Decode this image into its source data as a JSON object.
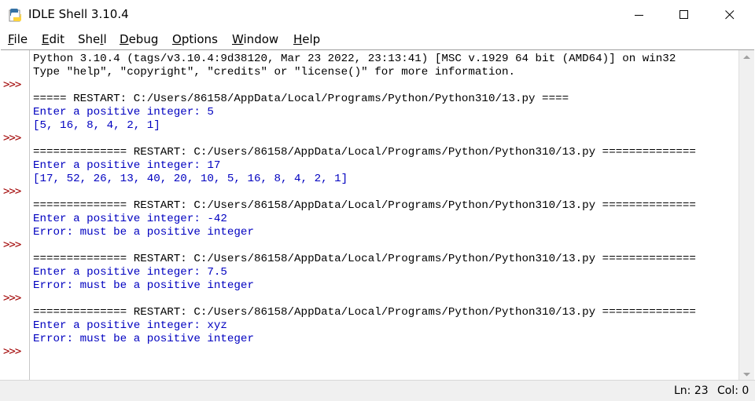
{
  "window": {
    "title": "IDLE Shell 3.10.4",
    "icon": "python-idle-icon"
  },
  "menu": {
    "items": [
      {
        "label_pre": "",
        "label_ul": "F",
        "label_post": "ile"
      },
      {
        "label_pre": "",
        "label_ul": "E",
        "label_post": "dit"
      },
      {
        "label_pre": "She",
        "label_ul": "l",
        "label_post": "l"
      },
      {
        "label_pre": "",
        "label_ul": "D",
        "label_post": "ebug"
      },
      {
        "label_pre": "",
        "label_ul": "O",
        "label_post": "ptions"
      },
      {
        "label_pre": "",
        "label_ul": "W",
        "label_post": "indow"
      },
      {
        "label_pre": "",
        "label_ul": "H",
        "label_post": "elp"
      }
    ]
  },
  "shell": {
    "prompt": ">>>",
    "lines": [
      {
        "text": "Python 3.10.4 (tags/v3.10.4:9d38120, Mar 23 2022, 23:13:41) [MSC v.1929 64 bit (AMD64)] on win32",
        "kind": "plain"
      },
      {
        "text": "Type \"help\", \"copyright\", \"credits\" or \"license()\" for more information.",
        "kind": "plain"
      },
      {
        "text": "",
        "kind": "plain"
      },
      {
        "text": "===== RESTART: C:/Users/86158/AppData/Local/Programs/Python/Python310/13.py ====",
        "kind": "plain"
      },
      {
        "text": "Enter a positive integer: 5",
        "kind": "stdout"
      },
      {
        "text": "[5, 16, 8, 4, 2, 1]",
        "kind": "stdout"
      },
      {
        "text": "",
        "kind": "plain"
      },
      {
        "text": "============== RESTART: C:/Users/86158/AppData/Local/Programs/Python/Python310/13.py ==============",
        "kind": "plain"
      },
      {
        "text": "Enter a positive integer: 17",
        "kind": "stdout"
      },
      {
        "text": "[17, 52, 26, 13, 40, 20, 10, 5, 16, 8, 4, 2, 1]",
        "kind": "stdout"
      },
      {
        "text": "",
        "kind": "plain"
      },
      {
        "text": "============== RESTART: C:/Users/86158/AppData/Local/Programs/Python/Python310/13.py ==============",
        "kind": "plain"
      },
      {
        "text": "Enter a positive integer: -42",
        "kind": "stdout"
      },
      {
        "text": "Error: must be a positive integer",
        "kind": "stdout"
      },
      {
        "text": "",
        "kind": "plain"
      },
      {
        "text": "============== RESTART: C:/Users/86158/AppData/Local/Programs/Python/Python310/13.py ==============",
        "kind": "plain"
      },
      {
        "text": "Enter a positive integer: 7.5",
        "kind": "stdout"
      },
      {
        "text": "Error: must be a positive integer",
        "kind": "stdout"
      },
      {
        "text": "",
        "kind": "plain"
      },
      {
        "text": "============== RESTART: C:/Users/86158/AppData/Local/Programs/Python/Python310/13.py ==============",
        "kind": "plain"
      },
      {
        "text": "Enter a positive integer: xyz",
        "kind": "stdout"
      },
      {
        "text": "Error: must be a positive integer",
        "kind": "stdout"
      },
      {
        "text": "",
        "kind": "plain"
      }
    ]
  },
  "status": {
    "line": "Ln: 23",
    "col": "Col: 0"
  },
  "colors": {
    "stdout": "#0000c0",
    "prompt": "#a00000"
  }
}
